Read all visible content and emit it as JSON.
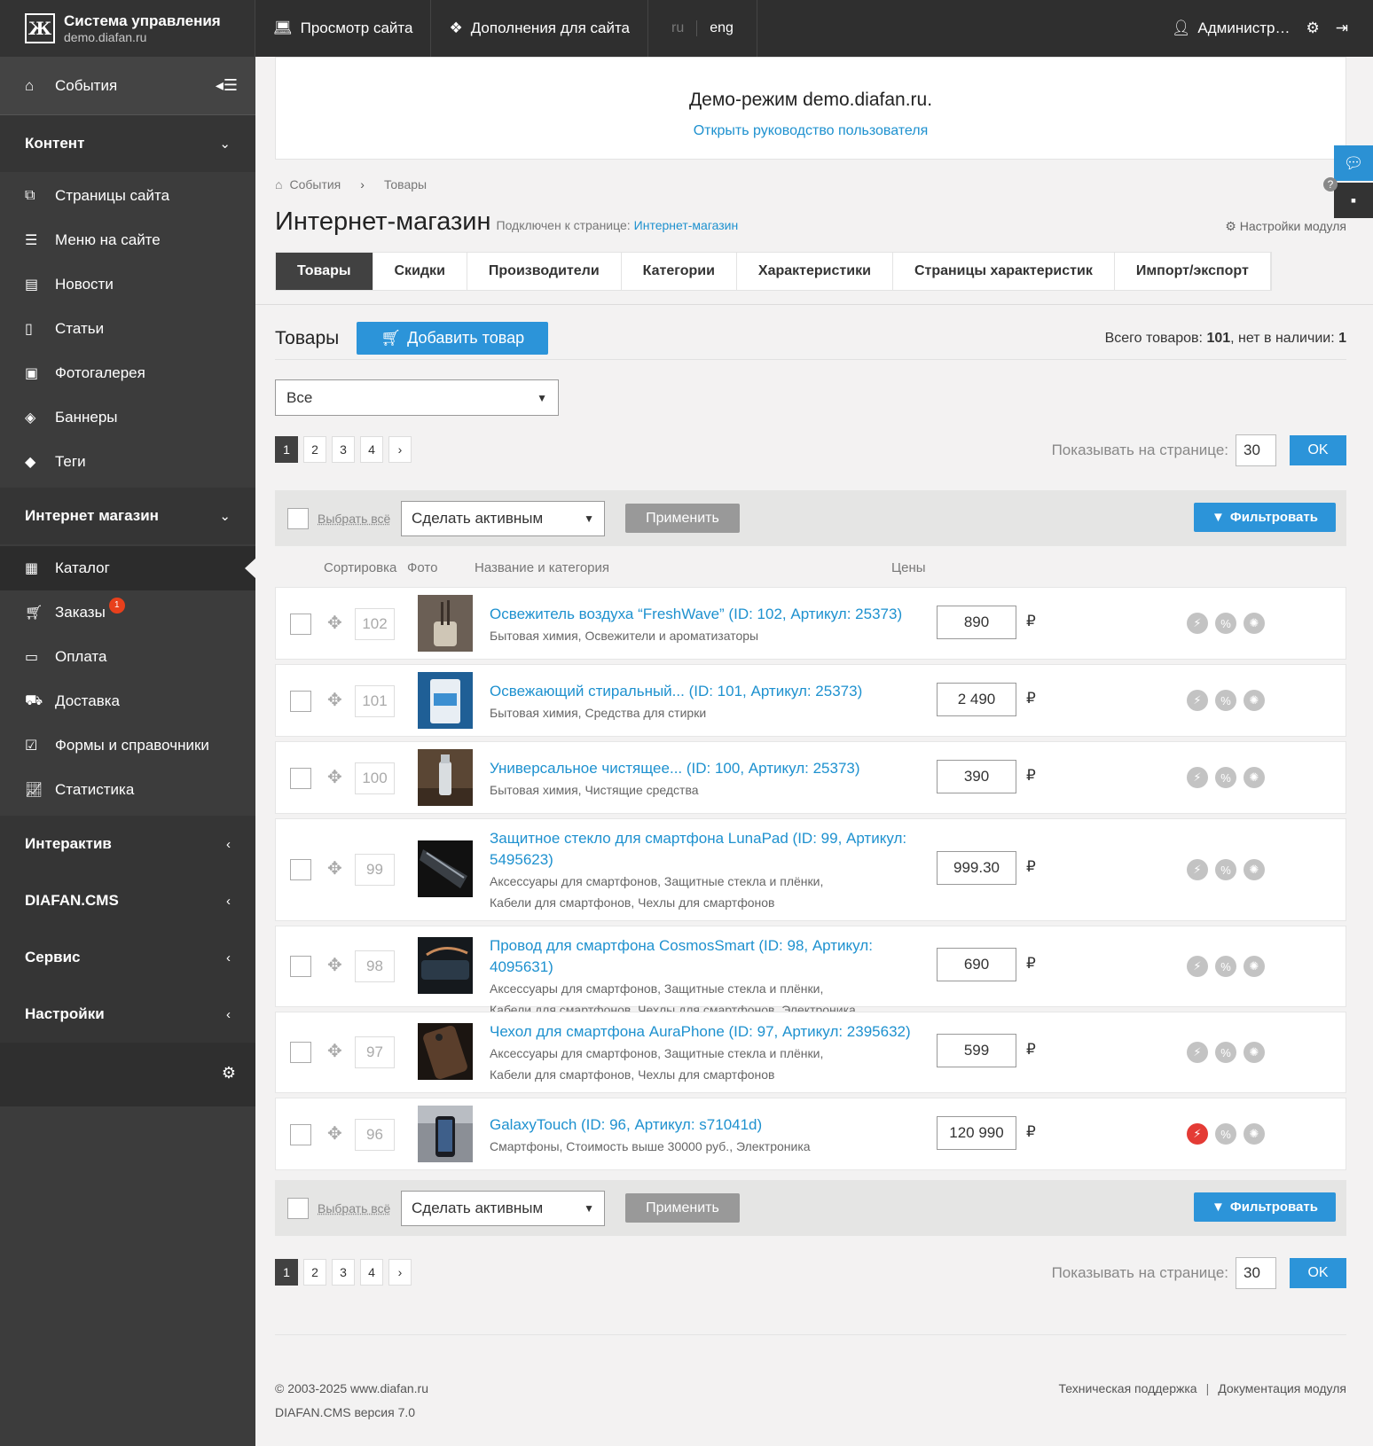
{
  "header": {
    "logo_title": "Система управления",
    "logo_subtitle": "demo.diafan.ru",
    "nav": [
      "Просмотр сайта",
      "Дополнения для сайта"
    ],
    "lang_ru": "ru",
    "lang_en": "eng",
    "user": "Администр…"
  },
  "sidebar": {
    "events": "События",
    "sections": {
      "content": "Контент",
      "shop": "Интернет магазин",
      "interactive": "Интерактив",
      "cms": "DIAFAN.CMS",
      "service": "Сервис",
      "settings": "Настройки"
    },
    "content_items": [
      "Страницы сайта",
      "Меню на сайте",
      "Новости",
      "Статьи",
      "Фотогалерея",
      "Баннеры",
      "Теги"
    ],
    "shop_items": [
      "Каталог",
      "Заказы",
      "Оплата",
      "Доставка",
      "Формы и справочники",
      "Статистика"
    ],
    "orders_badge": "1"
  },
  "demo": {
    "title": "Демо-режим demo.diafan.ru.",
    "link": "Открыть руководство пользователя"
  },
  "breadcrumb": [
    "События",
    "Товары"
  ],
  "module": {
    "title": "Интернет-магазин",
    "connected_label": "Подключен к странице:",
    "connected_link": "Интернет-магазин",
    "settings": "Настройки модуля"
  },
  "tabs": [
    "Товары",
    "Скидки",
    "Производители",
    "Категории",
    "Характеристики",
    "Страницы характеристик",
    "Импорт/экспорт"
  ],
  "list": {
    "title": "Товары",
    "add_button": "Добавить товар",
    "total_label": "Всего товаров:",
    "total_value": "101",
    "missing_label": ", нет в наличии:",
    "missing_value": "1"
  },
  "filter_select": "Все",
  "pages": [
    "1",
    "2",
    "3",
    "4",
    "›"
  ],
  "per_page_label": "Показывать на странице:",
  "per_page_value": "30",
  "ok": "OK",
  "actions": {
    "select_all": "Выбрать всё",
    "action": "Сделать активным",
    "apply": "Применить",
    "filter": "Фильтровать"
  },
  "columns": {
    "sort": "Сортировка",
    "photo": "Фото",
    "name": "Название и категория",
    "price": "Цены"
  },
  "currency": "₽",
  "products": [
    {
      "sort": "102",
      "name": "Освежитель воздуха “FreshWave” (ID: 102, Артикул: 25373)",
      "categories": [
        "Бытовая химия, Освежители и ароматизаторы"
      ],
      "price": "890",
      "hot": false
    },
    {
      "sort": "101",
      "name": "Освежающий стиральный... (ID: 101, Артикул: 25373)",
      "categories": [
        "Бытовая химия, Средства для стирки"
      ],
      "price": "2 490",
      "hot": false
    },
    {
      "sort": "100",
      "name": "Универсальное чистящее... (ID: 100, Артикул: 25373)",
      "categories": [
        "Бытовая химия, Чистящие средства"
      ],
      "price": "390",
      "hot": false
    },
    {
      "sort": "99",
      "name": "Защитное стекло для смартфона LunaPad (ID: 99, Артикул: 5495623)",
      "categories": [
        "Аксессуары для смартфонов, Защитные стекла и плёнки,",
        "Кабели для смартфонов, Чехлы для смартфонов"
      ],
      "price": "999.30",
      "hot": false
    },
    {
      "sort": "98",
      "name": "Провод для смартфона CosmosSmart (ID: 98, Артикул: 4095631)",
      "categories": [
        "Аксессуары для смартфонов, Защитные стекла и плёнки,",
        "Кабели для смартфонов, Чехлы для смартфонов, Электроника"
      ],
      "price": "690",
      "hot": false
    },
    {
      "sort": "97",
      "name": "Чехол для смартфона AuraPhone (ID: 97, Артикул: 2395632)",
      "categories": [
        "Аксессуары для смартфонов, Защитные стекла и плёнки,",
        "Кабели для смартфонов, Чехлы для смартфонов"
      ],
      "price": "599",
      "hot": false
    },
    {
      "sort": "96",
      "name": "GalaxyTouch (ID: 96, Артикул: s71041d)",
      "categories": [
        "Смартфоны, Стоимость выше 30000 руб., Электроника"
      ],
      "price": "120 990",
      "hot": true
    }
  ],
  "footer": {
    "copyright": "© 2003-2025 www.diafan.ru",
    "version": "DIAFAN.CMS версия 7.0",
    "support": "Техническая поддержка",
    "docs": "Документация модуля"
  },
  "colors": {
    "accent": "#2c94d9",
    "link": "#1e91cf",
    "sidebar": "#3c3c3c",
    "topbar": "#2f2f2f",
    "hot": "#e43b35"
  }
}
